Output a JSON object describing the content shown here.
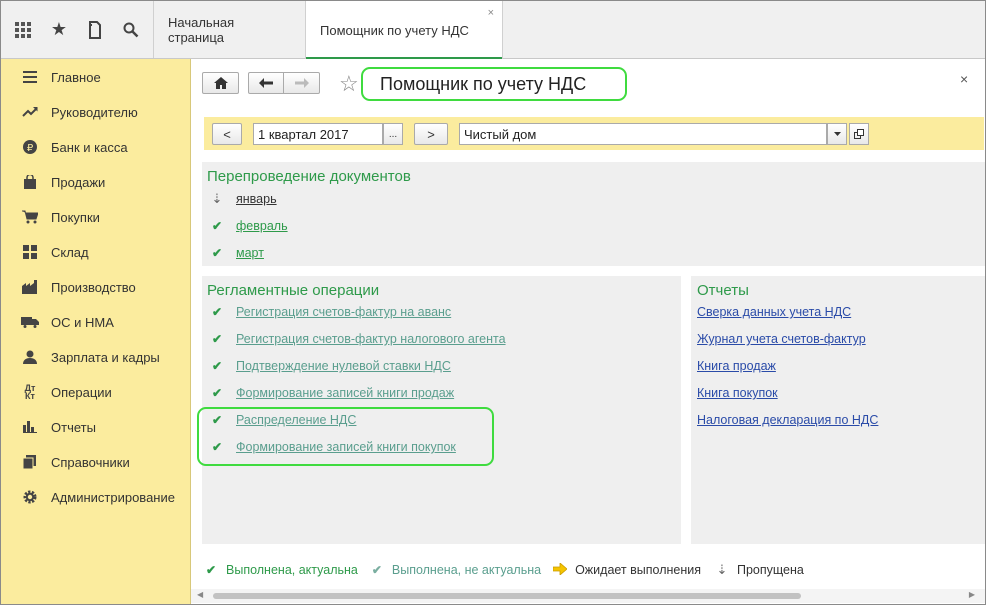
{
  "tabs": [
    {
      "label": "Начальная страница"
    },
    {
      "label": "Помощник по учету НДС",
      "close": "×"
    }
  ],
  "sidebar": {
    "items": [
      {
        "label": "Главное",
        "icon": "menu-icon"
      },
      {
        "label": "Руководителю",
        "icon": "trend-icon"
      },
      {
        "label": "Банк и касса",
        "icon": "ruble-icon"
      },
      {
        "label": "Продажи",
        "icon": "bag-icon"
      },
      {
        "label": "Покупки",
        "icon": "cart-icon"
      },
      {
        "label": "Склад",
        "icon": "grid-icon"
      },
      {
        "label": "Производство",
        "icon": "factory-icon"
      },
      {
        "label": "ОС и НМА",
        "icon": "truck-icon"
      },
      {
        "label": "Зарплата и кадры",
        "icon": "person-icon"
      },
      {
        "label": "Операции",
        "icon": "dt-kt-icon"
      },
      {
        "label": "Отчеты",
        "icon": "barchart-icon"
      },
      {
        "label": "Справочники",
        "icon": "books-icon"
      },
      {
        "label": "Администрирование",
        "icon": "gear-icon"
      }
    ]
  },
  "main": {
    "title": "Помощник по учету НДС",
    "close": "×",
    "period": "1 квартал 2017",
    "period_select": "...",
    "prev": "<",
    "next": ">",
    "org": "Чистый дом"
  },
  "reposting": {
    "title": "Перепроведение документов",
    "items": [
      {
        "label": "январь",
        "status": "skipped"
      },
      {
        "label": "февраль",
        "status": "done-actual"
      },
      {
        "label": "март",
        "status": "done-actual"
      }
    ]
  },
  "operations": {
    "title": "Регламентные операции",
    "items": [
      {
        "label": "Регистрация счетов-фактур на аванс"
      },
      {
        "label": "Регистрация счетов-фактур налогового агента"
      },
      {
        "label": "Подтверждение нулевой ставки НДС"
      },
      {
        "label": "Формирование записей книги продаж"
      },
      {
        "label": "Распределение НДС"
      },
      {
        "label": "Формирование записей книги покупок"
      }
    ]
  },
  "reports": {
    "title": "Отчеты",
    "items": [
      {
        "label": "Сверка данных учета НДС"
      },
      {
        "label": "Журнал учета счетов-фактур"
      },
      {
        "label": "Книга продаж"
      },
      {
        "label": "Книга покупок"
      },
      {
        "label": "Налоговая декларация по НДС"
      }
    ]
  },
  "legend": {
    "done_actual": "Выполнена, актуальна",
    "done_not_actual": "Выполнена, не актуальна",
    "waiting": "Ожидает выполнения",
    "skipped": "Пропущена"
  },
  "colors": {
    "accent_green": "#2e9a4a",
    "highlight": "#3fdb3f",
    "sidebar_bg": "#fbec9e",
    "link_blue": "#2a4ba8"
  }
}
